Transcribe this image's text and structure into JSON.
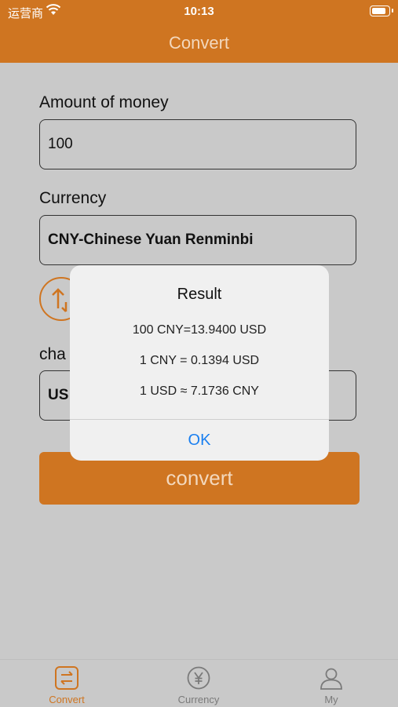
{
  "status": {
    "carrier": "运营商",
    "time": "10:13"
  },
  "nav": {
    "title": "Convert"
  },
  "form": {
    "amount_label": "Amount of money",
    "amount_value": "100",
    "currency_label": "Currency",
    "currency_value": "CNY-Chinese Yuan Renminbi",
    "change_label": "cha",
    "target_value": "US",
    "convert_label": "convert"
  },
  "dialog": {
    "title": "Result",
    "line1": "100 CNY=13.9400 USD",
    "line2": "1 CNY = 0.1394 USD",
    "line3": "1 USD ≈ 7.1736 CNY",
    "ok_label": "OK"
  },
  "tabs": [
    {
      "label": "Convert",
      "icon": "convert-icon",
      "active": true
    },
    {
      "label": "Currency",
      "icon": "yen-icon",
      "active": false
    },
    {
      "label": "My",
      "icon": "person-icon",
      "active": false
    }
  ],
  "colors": {
    "accent": "#cf7521",
    "background": "#c9c9c9",
    "link": "#1a7ff0"
  }
}
